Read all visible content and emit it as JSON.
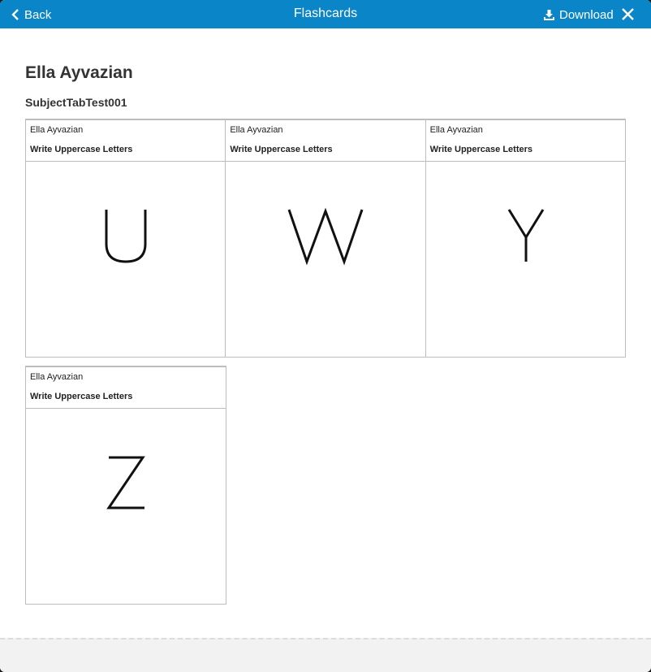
{
  "topbar": {
    "back_label": "Back",
    "title": "Flashcards",
    "download_label": "Download",
    "accent_color": "#0a86c8"
  },
  "student_name": "Ella Ayvazian",
  "subject": "SubjectTabTest001",
  "cards": [
    {
      "name": "Ella Ayvazian",
      "task": "Write Uppercase Letters",
      "letter": "U"
    },
    {
      "name": "Ella Ayvazian",
      "task": "Write Uppercase Letters",
      "letter": "W"
    },
    {
      "name": "Ella Ayvazian",
      "task": "Write Uppercase Letters",
      "letter": "Y"
    },
    {
      "name": "Ella Ayvazian",
      "task": "Write Uppercase Letters",
      "letter": "Z"
    }
  ]
}
